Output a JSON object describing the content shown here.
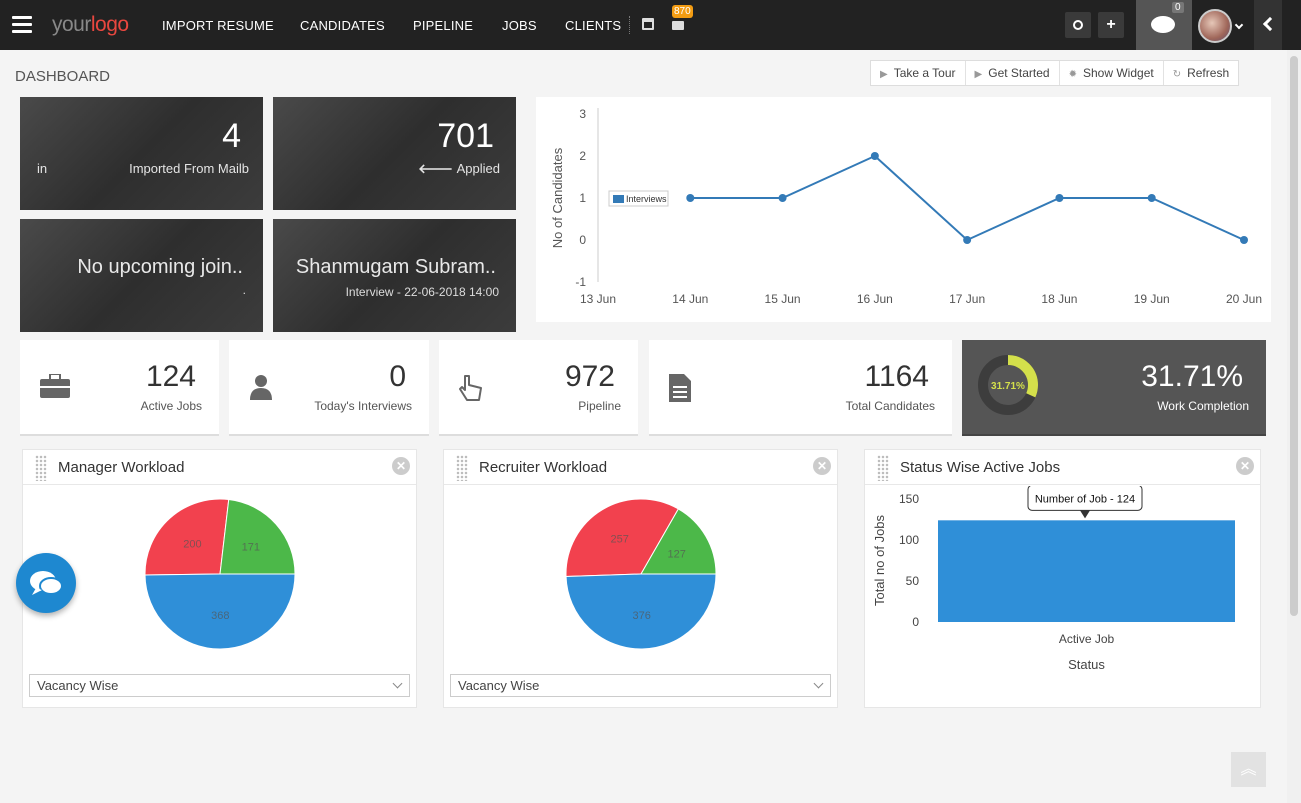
{
  "app": {
    "logo_part1": "your",
    "logo_part2": "logo",
    "nav": [
      "IMPORT RESUME",
      "CANDIDATES",
      "PIPELINE",
      "JOBS",
      "CLIENTS"
    ],
    "mail_badge": "870",
    "chat_badge": "0",
    "add_label": "+"
  },
  "page": {
    "title": "DASHBOARD",
    "actions": [
      "Take a Tour",
      "Get Started",
      "Show Widget",
      "Refresh"
    ]
  },
  "tiles": {
    "imported": {
      "value": "4",
      "left": "in",
      "label": "Imported From Mailb"
    },
    "applied": {
      "value": "701",
      "label": "Applied"
    },
    "joining": {
      "text": "No upcoming join..",
      "dot": "."
    },
    "interview": {
      "name": "Shanmugam Subram..",
      "detail": "Interview - 22-06-2018 14:00"
    }
  },
  "stats": [
    {
      "value": "124",
      "label": "Active Jobs"
    },
    {
      "value": "0",
      "label": "Today's Interviews"
    },
    {
      "value": "972",
      "label": "Pipeline"
    },
    {
      "value": "1164",
      "label": "Total Candidates"
    },
    {
      "value": "31.71%",
      "label": "Work Completion",
      "ring_label": "31.71%",
      "fraction": 0.3171
    }
  ],
  "colors": {
    "accent": "#337ab7",
    "red": "#f2414e",
    "green": "#4cb849",
    "blue": "#2f8fd8",
    "ring": "#d4e04b"
  },
  "panels": {
    "manager": {
      "title": "Manager Workload",
      "select": "Vacancy Wise"
    },
    "recruiter": {
      "title": "Recruiter Workload",
      "select": "Vacancy Wise"
    },
    "status": {
      "title": "Status Wise Active Jobs"
    }
  },
  "chart_data": [
    {
      "type": "line",
      "ylabel": "No of Candidates",
      "x": [
        "13 Jun",
        "14 Jun",
        "15 Jun",
        "16 Jun",
        "17 Jun",
        "18 Jun",
        "19 Jun",
        "20 Jun"
      ],
      "series": [
        {
          "name": "Interviews",
          "values": [
            null,
            1,
            1,
            2,
            0,
            1,
            1,
            0
          ]
        }
      ],
      "ylim": [
        -1,
        3
      ],
      "yticks": [
        -1,
        0,
        1,
        2,
        3
      ],
      "legend": "left"
    },
    {
      "type": "pie",
      "labels": [
        "200",
        "171",
        "368"
      ],
      "values": [
        200,
        171,
        368
      ],
      "colors": [
        "#f2414e",
        "#4cb849",
        "#2f8fd8"
      ]
    },
    {
      "type": "pie",
      "labels": [
        "257",
        "127",
        "376"
      ],
      "values": [
        257,
        127,
        376
      ],
      "colors": [
        "#f2414e",
        "#4cb849",
        "#2f8fd8"
      ]
    },
    {
      "type": "bar",
      "categories": [
        "Active Job"
      ],
      "values": [
        124
      ],
      "xlabel": "Status",
      "ylabel": "Total no of Jobs",
      "ylim": [
        0,
        150
      ],
      "yticks": [
        0,
        50,
        100,
        150
      ],
      "tooltip": "Number of Job - 124"
    }
  ]
}
